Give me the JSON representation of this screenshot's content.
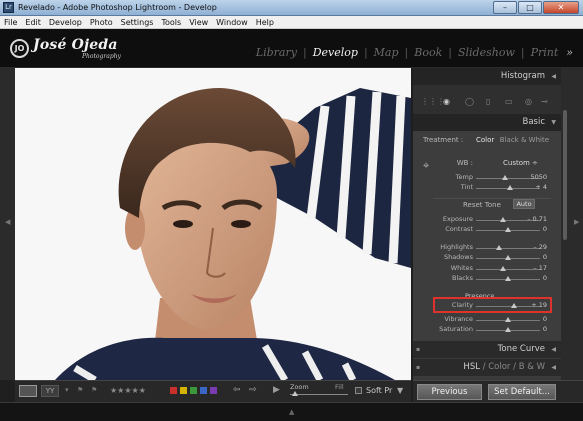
{
  "window": {
    "title": "Revelado - Adobe Photoshop Lightroom - Develop",
    "icon": "Lr",
    "minimize": "–",
    "maximize": "□",
    "close": "✕"
  },
  "menu": [
    "File",
    "Edit",
    "Develop",
    "Photo",
    "Settings",
    "Tools",
    "View",
    "Window",
    "Help"
  ],
  "identity_plate": {
    "monogram": "JO",
    "name": "José Ojeda",
    "tagline": "Photography"
  },
  "modules": {
    "items": [
      "Library",
      "Develop",
      "Map",
      "Book",
      "Slideshow",
      "Print"
    ],
    "active": "Develop",
    "more": "»"
  },
  "panels": {
    "histogram": {
      "title": "Histogram",
      "arrow": "◀"
    },
    "basic": {
      "title": "Basic",
      "arrow": "▼",
      "treatment": {
        "label": "Treatment :",
        "color": "Color",
        "bw": "Black & White"
      },
      "wb": {
        "label": "WB :",
        "value": "Custom ÷"
      },
      "reset_tone": "Reset Tone",
      "auto": "Auto",
      "presence": "Presence",
      "sliders": [
        {
          "label": "Temp",
          "value": "5050",
          "pos": 0.45
        },
        {
          "label": "Tint",
          "value": "+ 4",
          "pos": 0.53
        },
        {
          "label": "Exposure",
          "value": "– 0.71",
          "pos": 0.42
        },
        {
          "label": "Contrast",
          "value": "0",
          "pos": 0.5
        },
        {
          "label": "Highlights",
          "value": "– 29",
          "pos": 0.36
        },
        {
          "label": "Shadows",
          "value": "0",
          "pos": 0.5
        },
        {
          "label": "Whites",
          "value": "– 17",
          "pos": 0.42
        },
        {
          "label": "Blacks",
          "value": "0",
          "pos": 0.5
        },
        {
          "label": "Clarity",
          "value": "+ 19",
          "pos": 0.6
        },
        {
          "label": "Vibrance",
          "value": "0",
          "pos": 0.5
        },
        {
          "label": "Saturation",
          "value": "0",
          "pos": 0.5
        }
      ]
    },
    "tone_curve": {
      "title": "Tone Curve",
      "arrow": "◀"
    },
    "hsl": {
      "title": "HSL",
      "sep1": "/",
      "color": "Color",
      "sep2": "/",
      "bw": "B & W",
      "arrow": "◀"
    }
  },
  "toolbar": {
    "stars": "★★★★★",
    "prev_arrow": "⇦",
    "next_arrow": "⇨",
    "play": "▶",
    "zoom_label": "Zoom",
    "fill_label": "Fill",
    "soft_proof": "Soft Pr",
    "soft_arrow": "▼",
    "flag_pick": "⚑",
    "flag_reject": "⚑",
    "yy": "YY"
  },
  "color_labels": [
    "#c9302c",
    "#d4b400",
    "#3a9a3a",
    "#3a66c4",
    "#7a3ab0"
  ],
  "buttons": {
    "previous": "Previous",
    "set_default": "Set Default..."
  },
  "icons": [
    "crop-icon",
    "spot-removal-icon",
    "red-eye-icon",
    "graduated-filter-icon",
    "radial-filter-icon",
    "adjustment-brush-icon",
    "eyedropper-icon"
  ]
}
